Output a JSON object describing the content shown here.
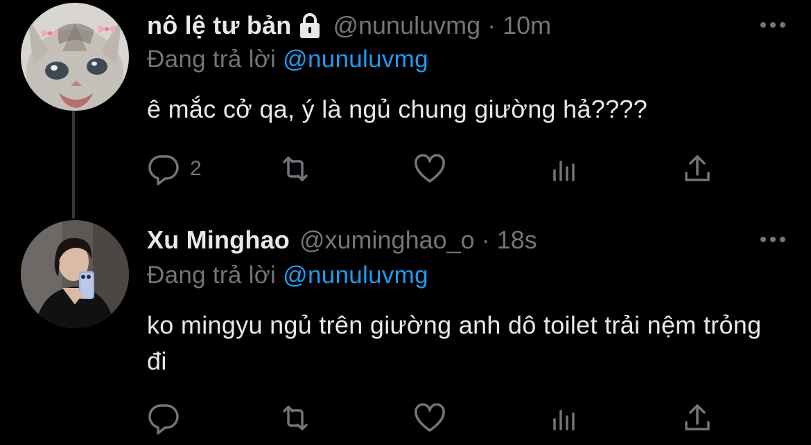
{
  "tweets": [
    {
      "display_name": "nô lệ tư bản",
      "protected_icon": "lock-icon",
      "handle": "@nunuluvmg",
      "separator": "·",
      "time": "10m",
      "reply_prefix": "Đang trả lời",
      "reply_to": "@nunuluvmg",
      "text": "ê mắc cở qa, ý là ngủ chung giường hả????",
      "reply_count": "2",
      "avatar": "kitten-avatar"
    },
    {
      "display_name": "Xu Minghao",
      "handle": "@xuminghao_o",
      "separator": "·",
      "time": "18s",
      "reply_prefix": "Đang trả lời",
      "reply_to": "@nunuluvmg",
      "text": "ko mingyu ngủ trên giường anh dô toilet trải nệm trỏng đi",
      "reply_count": "",
      "avatar": "person-avatar"
    }
  ],
  "icons": {
    "more": "more-icon",
    "reply": "reply-icon",
    "retweet": "retweet-icon",
    "like": "heart-icon",
    "views": "views-icon",
    "share": "share-icon"
  },
  "colors": {
    "background": "#000000",
    "text": "#e7e9ea",
    "secondary": "#71767b",
    "accent": "#1d9bf0"
  }
}
